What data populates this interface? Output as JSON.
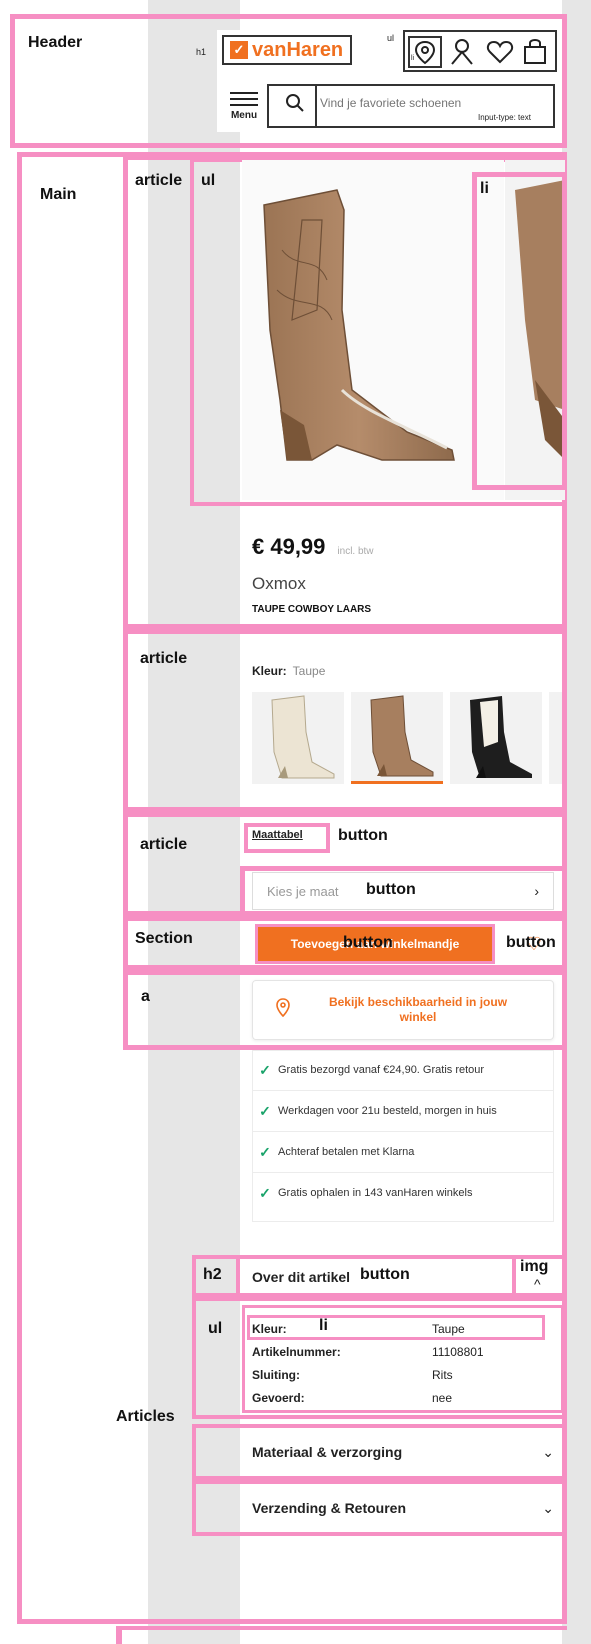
{
  "annotations": {
    "header": "Header",
    "h1": "h1",
    "ul": "ul",
    "li": "li",
    "input_type": "Input-type: text",
    "main": "Main",
    "article": "article",
    "section": "Section",
    "a": "a",
    "button": "button",
    "h2": "h2",
    "img": "img",
    "articles": "Articles"
  },
  "header": {
    "brand": "vanHaren",
    "menu_label": "Menu",
    "search_placeholder": "Vind je favoriete schoenen",
    "icons": [
      "location-pin-icon",
      "user-icon",
      "heart-icon",
      "bag-icon",
      "search-icon",
      "hamburger-icon"
    ]
  },
  "product": {
    "price": "€ 49,99",
    "price_note": "incl. btw",
    "brand": "Oxmox",
    "name": "TAUPE COWBOY LAARS",
    "color_label": "Kleur:",
    "color_value": "Taupe",
    "variants": [
      "cream",
      "taupe",
      "black-white"
    ],
    "size_table": "Maattabel",
    "size_select": "Kies je maat",
    "add_to_cart": "Toevoegen aan winkelmandje",
    "store_availability": "Bekijk beschikbaarheid in jouw winkel"
  },
  "usps": [
    "Gratis bezorgd vanaf €24,90. Gratis retour",
    "Werkdagen voor 21u besteld, morgen in huis",
    "Achteraf betalen met Klarna",
    "Gratis ophalen in 143 vanHaren winkels"
  ],
  "details": {
    "title": "Over dit artikel",
    "specs": [
      {
        "k": "Kleur:",
        "v": "Taupe"
      },
      {
        "k": "Artikelnummer:",
        "v": "11108801"
      },
      {
        "k": "Sluiting:",
        "v": "Rits"
      },
      {
        "k": "Gevoerd:",
        "v": "nee"
      }
    ],
    "material": "Materiaal & verzorging",
    "shipping": "Verzending & Retouren"
  },
  "colors": {
    "brand_orange": "#f07020",
    "annotation_pink": "#f68fc3",
    "check_green": "#1aa36a"
  }
}
